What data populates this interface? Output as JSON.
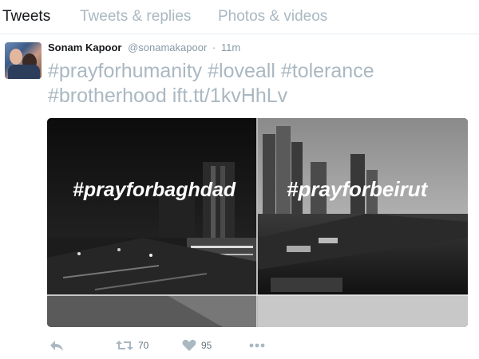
{
  "tabs": [
    {
      "label": "Tweets",
      "active": true
    },
    {
      "label": "Tweets & replies",
      "active": false
    },
    {
      "label": "Photos & videos",
      "active": false
    }
  ],
  "tweet": {
    "name": "Sonam Kapoor",
    "handle": "@sonamakapoor",
    "separator": "·",
    "time": "11m",
    "text_line1": "#prayforhumanity #loveall #tolerance",
    "text_line2": "#brotherhood ift.tt/1kvHhLv",
    "hashtags_line1": [
      "#prayforhumanity",
      "#loveall",
      "#tolerance"
    ],
    "hashtag_brotherhood": "#brotherhood",
    "link": "ift.tt/1kvHhLv"
  },
  "media": {
    "left_caption": "#prayforbaghdad",
    "right_caption": "#prayforbeirut"
  },
  "actions": {
    "reply_icon": "reply-icon",
    "retweet_icon": "retweet-icon",
    "retweet_count": "70",
    "like_icon": "heart-icon",
    "like_count": "95",
    "more_icon": "more-icon"
  },
  "colors": {
    "muted_text": "#aab8c2",
    "name_text": "#14171a",
    "divider": "#e6ecf0"
  }
}
